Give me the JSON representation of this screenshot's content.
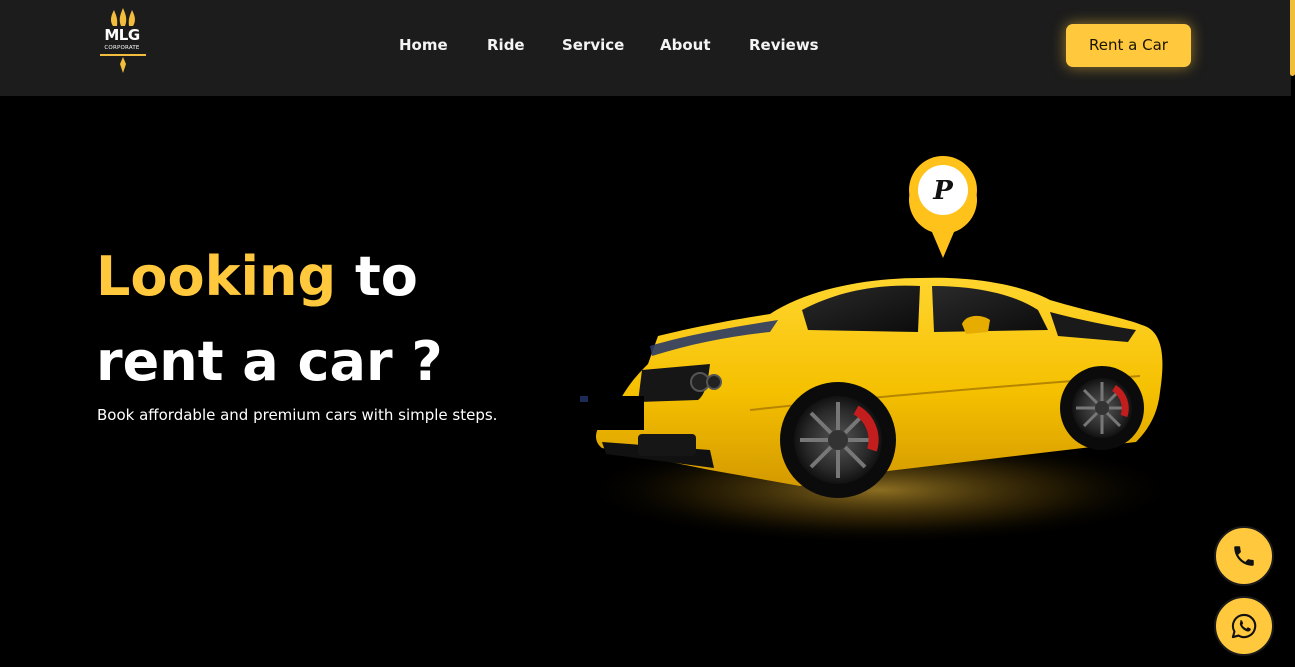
{
  "brand": {
    "logo_text": "MLG",
    "logo_subtext": "CORPORATE"
  },
  "nav": {
    "items": [
      {
        "label": "Home"
      },
      {
        "label": "Ride"
      },
      {
        "label": "Service"
      },
      {
        "label": "About"
      },
      {
        "label": "Reviews"
      }
    ],
    "cta_label": "Rent a Car"
  },
  "hero": {
    "title_accent": "Looking",
    "title_rest": " to",
    "title_line2": "rent a car ?",
    "subtitle": "Book affordable and premium cars with simple steps.",
    "pin_letter": "P"
  },
  "floating_actions": {
    "call_icon": "phone-icon",
    "whatsapp_icon": "whatsapp-icon"
  },
  "colors": {
    "accent": "#ffc83d",
    "header_bg": "#1c1c1c",
    "page_bg": "#000000",
    "text": "#ffffff"
  }
}
